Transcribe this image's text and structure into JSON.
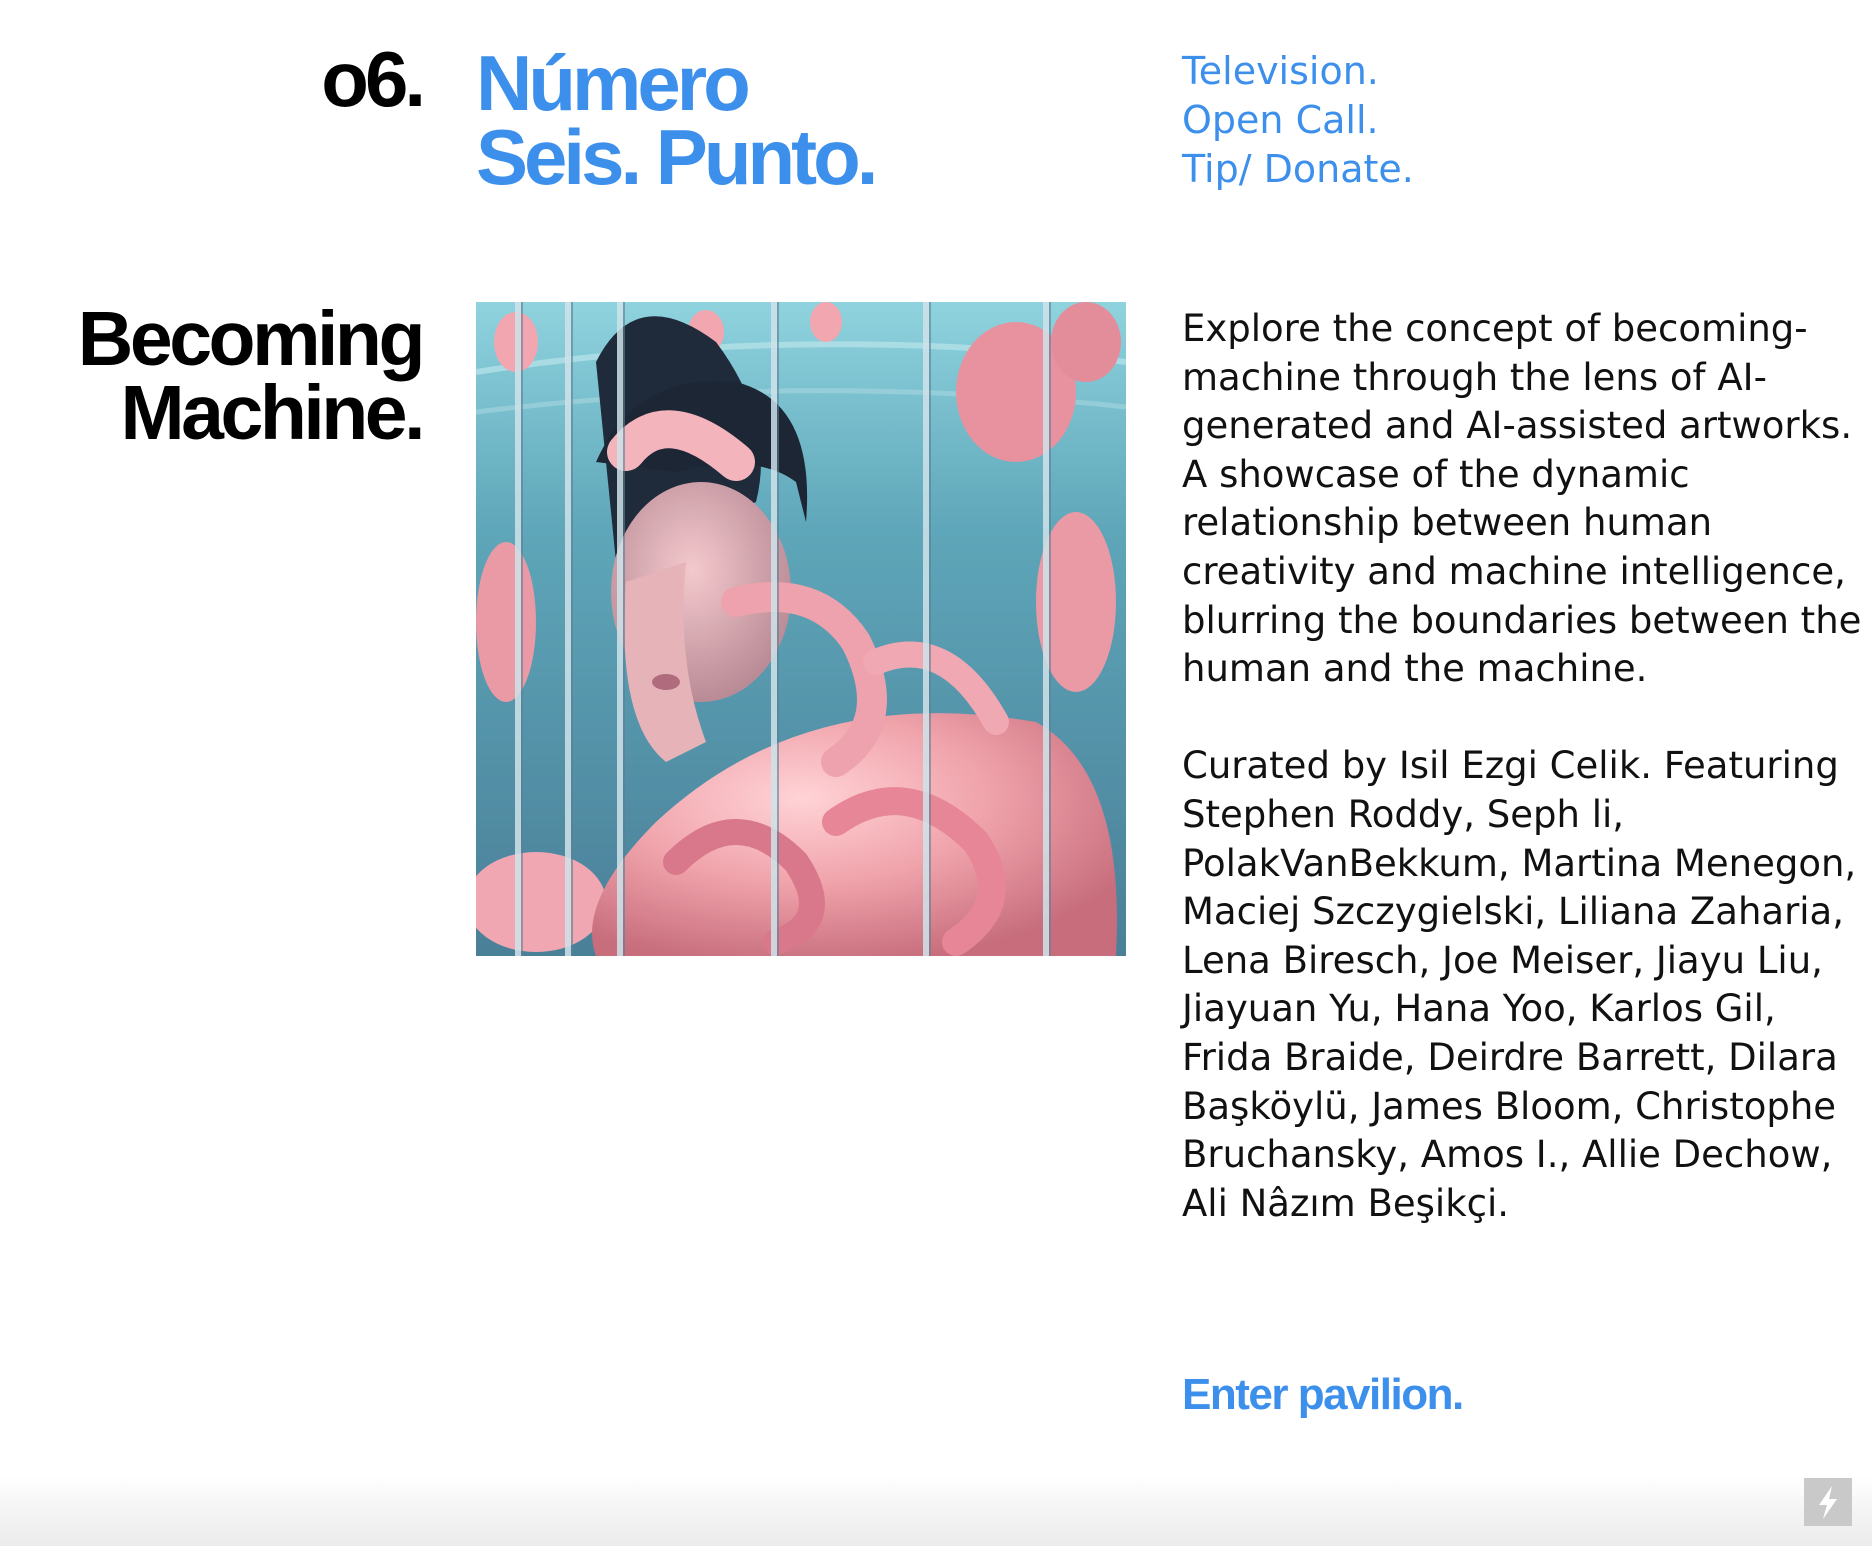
{
  "header": {
    "issue_number": "o6.",
    "title_line1": "Número",
    "title_line2": "Seis. Punto."
  },
  "nav": {
    "items": [
      {
        "label": "Television."
      },
      {
        "label": "Open Call."
      },
      {
        "label": "Tip/ Donate."
      }
    ]
  },
  "exhibit": {
    "title_line1": "Becoming",
    "title_line2": "Machine.",
    "artwork_icon": "artwork-image",
    "description": "Explore the concept of becoming-machine through the lens of AI-generated and AI-assisted artworks. A showcase of the dynamic relationship between human creativity and machine intelligence, blurring the boundaries between the human and the machine.",
    "credits": "Curated by Isil Ezgi Celik. Featuring Stephen Roddy, Seph li, PolakVanBekkum, Martina Menegon, Maciej Szczygielski, Liliana Zaharia, Lena Biresch, Joe Meiser, Jiayu Liu, Jiayuan Yu, Hana Yoo, Karlos Gil, Frida Braide, Deirdre Barrett, Dilara Başköylü, James Bloom, Christophe Bruchansky, Amos I., Allie Dechow, Ali Nâzım Beşikçi.",
    "cta_label": "Enter pavilion."
  },
  "footer": {
    "action_icon": "lightning-bolt-icon"
  },
  "colors": {
    "accent": "#3d8fec",
    "text": "#111111",
    "background": "#ffffff"
  }
}
